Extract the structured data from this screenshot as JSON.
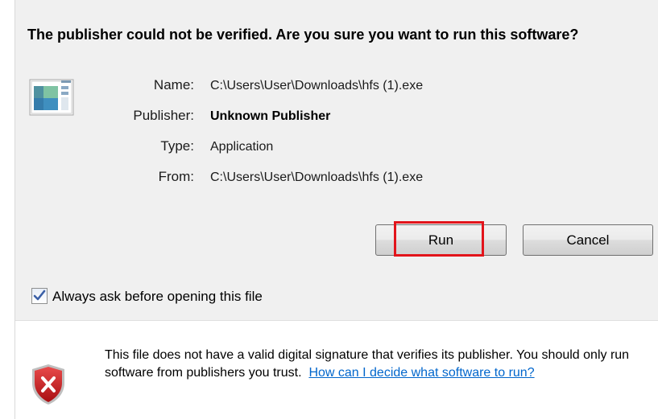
{
  "dialog": {
    "headline": "The publisher could not be verified.  Are you sure you want to run this software?",
    "icons": {
      "file": "application-file-icon",
      "shield": "security-shield-x-icon"
    },
    "fields": [
      {
        "label": "Name:",
        "value": "C:\\Users\\User\\Downloads\\hfs (1).exe",
        "bold": false
      },
      {
        "label": "Publisher:",
        "value": "Unknown Publisher",
        "bold": true
      },
      {
        "label": "Type:",
        "value": "Application",
        "bold": false
      },
      {
        "label": "From:",
        "value": "C:\\Users\\User\\Downloads\\hfs (1).exe",
        "bold": false
      }
    ],
    "buttons": {
      "run": "Run",
      "cancel": "Cancel"
    },
    "checkbox": {
      "label": "Always ask before opening this file",
      "checked": true
    },
    "warning": {
      "text": "This file does not have a valid digital signature that verifies its publisher. You should only run software from publishers you trust.",
      "link": "How can I decide what software to run?"
    },
    "colors": {
      "highlight": "#e2141b",
      "link": "#0066cc",
      "upper_bg": "#f0f0f0"
    }
  }
}
